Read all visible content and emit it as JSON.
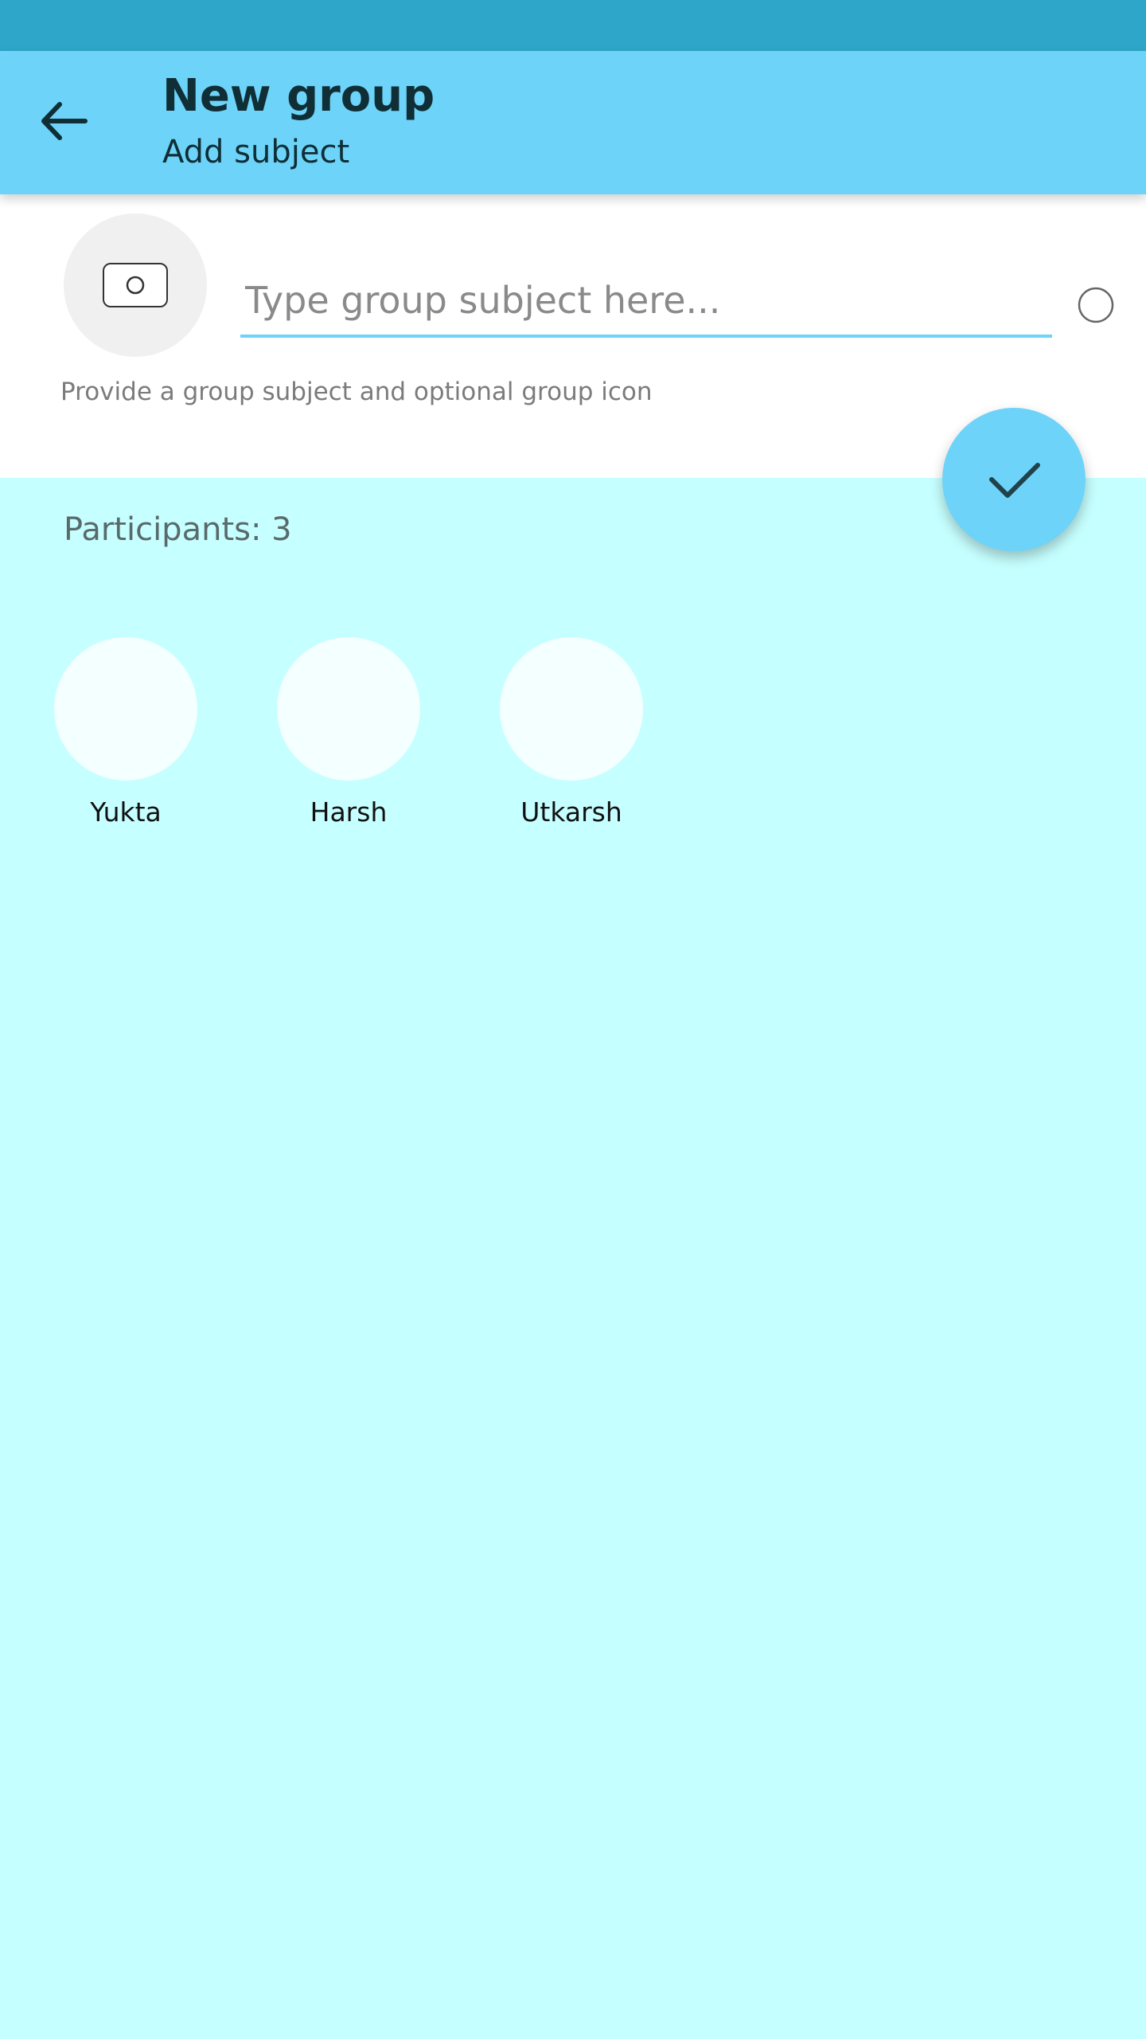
{
  "colors": {
    "status_bar": "#2ea6c9",
    "app_bar": "#6dd3f8",
    "accent": "#6dd3f8",
    "background": "#c6ffff",
    "title_text": "#0f2e36"
  },
  "header": {
    "back_icon": "arrow-back-icon",
    "title": "New group",
    "subtitle": "Add subject"
  },
  "subject": {
    "group_icon": "camera-icon",
    "input_value": "",
    "placeholder": "Type group subject here...",
    "emoji_icon": "emoji-icon",
    "helper": "Provide a group subject and optional group icon"
  },
  "fab": {
    "icon": "check-icon"
  },
  "participants": {
    "count_label": "Participants: 3",
    "items": [
      {
        "name": "Yukta"
      },
      {
        "name": "Harsh"
      },
      {
        "name": "Utkarsh"
      }
    ]
  }
}
